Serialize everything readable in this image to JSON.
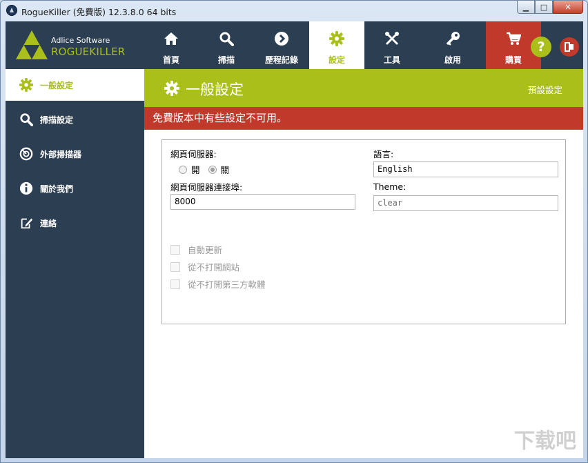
{
  "window": {
    "title": "RogueKiller (免費版) 12.3.8.0 64 bits",
    "buttons": {
      "minimize": "▁",
      "maximize": "□",
      "close": "✕"
    }
  },
  "logo": {
    "subtitle": "Adlice Software",
    "name": "ROGUEKILLER"
  },
  "nav": {
    "items": [
      {
        "label": "首頁",
        "icon": "home-icon"
      },
      {
        "label": "掃描",
        "icon": "search-icon"
      },
      {
        "label": "歷程記錄",
        "icon": "chevron-right-icon"
      },
      {
        "label": "設定",
        "icon": "gear-icon"
      },
      {
        "label": "工具",
        "icon": "tools-icon"
      },
      {
        "label": "啟用",
        "icon": "key-icon"
      },
      {
        "label": "購買",
        "icon": "cart-icon"
      }
    ],
    "active": "設定",
    "help": "?"
  },
  "sidebar": {
    "items": [
      {
        "label": "一般設定",
        "icon": "gear-icon"
      },
      {
        "label": "掃描設定",
        "icon": "search-icon"
      },
      {
        "label": "外部掃描器",
        "icon": "scanner-icon"
      },
      {
        "label": "關於我們",
        "icon": "info-icon"
      },
      {
        "label": "連絡",
        "icon": "contact-icon"
      }
    ],
    "active": "一般設定"
  },
  "header": {
    "title": "一般設定",
    "default_link": "預設設定"
  },
  "warning": "免費版本中有些設定不可用。",
  "form": {
    "webserver_label": "網頁伺服器:",
    "radio_on": "開",
    "radio_off": "關",
    "port_label": "網頁伺服器連接埠:",
    "port_value": "8000",
    "language_label": "語言:",
    "language_value": "English",
    "theme_label": "Theme:",
    "theme_value": "clear",
    "checkboxes": [
      "自動更新",
      "從不打開網站",
      "從不打開第三方軟體"
    ]
  },
  "watermark": "下载吧",
  "colors": {
    "accent": "#aabf1a",
    "dark": "#2c3e52",
    "danger": "#c0392b"
  }
}
